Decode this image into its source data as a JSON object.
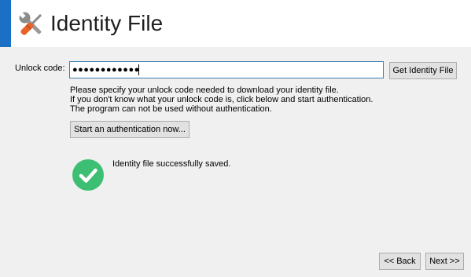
{
  "header": {
    "title": "Identity File",
    "icon": "tools-icon",
    "accent_color": "#1b6fc4"
  },
  "unlock": {
    "label": "Unlock code:",
    "masked_value": "●●●●●●●●●●●●",
    "get_button_label": "Get Identity File"
  },
  "info": {
    "line1": "Please specify your unlock code needed to download your identity file.",
    "line2": "If you don't know what your unlock code is, click below and start authentication.",
    "line3": "The program can not be used without authentication."
  },
  "auth": {
    "button_label": "Start an authentication now..."
  },
  "status": {
    "icon": "check-circle-icon",
    "color": "#3dbf73",
    "message": "Identity file successfully saved."
  },
  "nav": {
    "back_label": "<< Back",
    "next_label": "Next >>"
  }
}
